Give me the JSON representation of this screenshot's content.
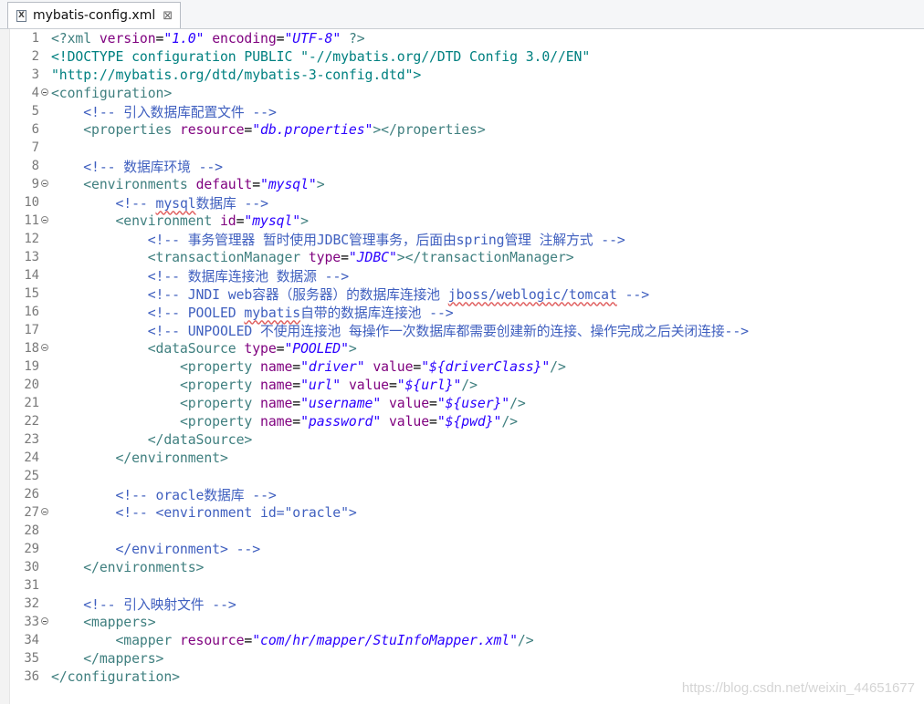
{
  "tab": {
    "title": "mybatis-config.xml",
    "icon": "xml-file-icon",
    "close_glyph": "⊠"
  },
  "watermark": "https://blog.csdn.net/weixin_44651677",
  "lines": [
    {
      "n": "1",
      "fold": false,
      "tokens": [
        [
          "pi",
          "<?xml "
        ],
        [
          "attr",
          "version"
        ],
        [
          "txt",
          "="
        ],
        [
          "val",
          "\"1.0\""
        ],
        [
          "txt",
          " "
        ],
        [
          "attr",
          "encoding"
        ],
        [
          "txt",
          "="
        ],
        [
          "val",
          "\"UTF-8\""
        ],
        [
          "txt",
          " "
        ],
        [
          "pi",
          "?>"
        ]
      ]
    },
    {
      "n": "2",
      "fold": false,
      "tokens": [
        [
          "doc",
          "<!DOCTYPE configuration PUBLIC \"-//mybatis.org//DTD Config 3.0//EN\""
        ]
      ]
    },
    {
      "n": "3",
      "fold": false,
      "tokens": [
        [
          "doc",
          "\"http://mybatis.org/dtd/mybatis-3-config.dtd\">"
        ]
      ]
    },
    {
      "n": "4",
      "fold": true,
      "tokens": [
        [
          "tag",
          "<configuration>"
        ]
      ]
    },
    {
      "n": "5",
      "fold": false,
      "tokens": [
        [
          "txt",
          "    "
        ],
        [
          "com",
          "<!-- 引入数据库配置文件 -->"
        ]
      ]
    },
    {
      "n": "6",
      "fold": false,
      "tokens": [
        [
          "txt",
          "    "
        ],
        [
          "tag",
          "<properties "
        ],
        [
          "attr",
          "resource"
        ],
        [
          "txt",
          "="
        ],
        [
          "val",
          "\"db.properties\""
        ],
        [
          "tag",
          "></properties>"
        ]
      ]
    },
    {
      "n": "7",
      "fold": false,
      "tokens": []
    },
    {
      "n": "8",
      "fold": false,
      "tokens": [
        [
          "txt",
          "    "
        ],
        [
          "com",
          "<!-- 数据库环境 -->"
        ]
      ]
    },
    {
      "n": "9",
      "fold": true,
      "tokens": [
        [
          "txt",
          "    "
        ],
        [
          "tag",
          "<environments "
        ],
        [
          "attr",
          "default"
        ],
        [
          "txt",
          "="
        ],
        [
          "val",
          "\"mysql\""
        ],
        [
          "tag",
          ">"
        ]
      ]
    },
    {
      "n": "10",
      "fold": false,
      "tokens": [
        [
          "txt",
          "        "
        ],
        [
          "com",
          "<!-- "
        ],
        [
          "comspell",
          "mysql"
        ],
        [
          "com",
          "数据库 -->"
        ]
      ]
    },
    {
      "n": "11",
      "fold": true,
      "tokens": [
        [
          "txt",
          "        "
        ],
        [
          "tag",
          "<environment "
        ],
        [
          "attr",
          "id"
        ],
        [
          "txt",
          "="
        ],
        [
          "val",
          "\"mysql\""
        ],
        [
          "tag",
          ">"
        ]
      ]
    },
    {
      "n": "12",
      "fold": false,
      "tokens": [
        [
          "txt",
          "            "
        ],
        [
          "com",
          "<!-- 事务管理器 暂时使用JDBC管理事务，后面由spring管理 注解方式 -->"
        ]
      ]
    },
    {
      "n": "13",
      "fold": false,
      "tokens": [
        [
          "txt",
          "            "
        ],
        [
          "tag",
          "<transactionManager "
        ],
        [
          "attr",
          "type"
        ],
        [
          "txt",
          "="
        ],
        [
          "val",
          "\"JDBC\""
        ],
        [
          "tag",
          "></transactionManager>"
        ]
      ]
    },
    {
      "n": "14",
      "fold": false,
      "tokens": [
        [
          "txt",
          "            "
        ],
        [
          "com",
          "<!-- 数据库连接池 数据源 -->"
        ]
      ]
    },
    {
      "n": "15",
      "fold": false,
      "tokens": [
        [
          "txt",
          "            "
        ],
        [
          "com",
          "<!-- JNDI web容器（服务器）的数据库连接池 "
        ],
        [
          "comspell",
          "jboss/weblogic/tomcat"
        ],
        [
          "com",
          " -->"
        ]
      ]
    },
    {
      "n": "16",
      "fold": false,
      "tokens": [
        [
          "txt",
          "            "
        ],
        [
          "com",
          "<!-- POOLED "
        ],
        [
          "comspell",
          "mybatis"
        ],
        [
          "com",
          "自带的数据库连接池 -->"
        ]
      ]
    },
    {
      "n": "17",
      "fold": false,
      "tokens": [
        [
          "txt",
          "            "
        ],
        [
          "com",
          "<!-- UNPOOLED 不使用连接池 每操作一次数据库都需要创建新的连接、操作完成之后关闭连接-->"
        ]
      ]
    },
    {
      "n": "18",
      "fold": true,
      "tokens": [
        [
          "txt",
          "            "
        ],
        [
          "tag",
          "<dataSource "
        ],
        [
          "attr",
          "type"
        ],
        [
          "txt",
          "="
        ],
        [
          "val",
          "\"POOLED\""
        ],
        [
          "tag",
          ">"
        ]
      ]
    },
    {
      "n": "19",
      "fold": false,
      "tokens": [
        [
          "txt",
          "                "
        ],
        [
          "tag",
          "<property "
        ],
        [
          "attr",
          "name"
        ],
        [
          "txt",
          "="
        ],
        [
          "val",
          "\"driver\""
        ],
        [
          "txt",
          " "
        ],
        [
          "attr",
          "value"
        ],
        [
          "txt",
          "="
        ],
        [
          "val",
          "\"${driverClass}\""
        ],
        [
          "tag",
          "/>"
        ]
      ]
    },
    {
      "n": "20",
      "fold": false,
      "tokens": [
        [
          "txt",
          "                "
        ],
        [
          "tag",
          "<property "
        ],
        [
          "attr",
          "name"
        ],
        [
          "txt",
          "="
        ],
        [
          "val",
          "\"url\""
        ],
        [
          "txt",
          " "
        ],
        [
          "attr",
          "value"
        ],
        [
          "txt",
          "="
        ],
        [
          "val",
          "\"${url}\""
        ],
        [
          "tag",
          "/>"
        ]
      ]
    },
    {
      "n": "21",
      "fold": false,
      "tokens": [
        [
          "txt",
          "                "
        ],
        [
          "tag",
          "<property "
        ],
        [
          "attr",
          "name"
        ],
        [
          "txt",
          "="
        ],
        [
          "val",
          "\"username\""
        ],
        [
          "txt",
          " "
        ],
        [
          "attr",
          "value"
        ],
        [
          "txt",
          "="
        ],
        [
          "val",
          "\"${user}\""
        ],
        [
          "tag",
          "/>"
        ]
      ]
    },
    {
      "n": "22",
      "fold": false,
      "tokens": [
        [
          "txt",
          "                "
        ],
        [
          "tag",
          "<property "
        ],
        [
          "attr",
          "name"
        ],
        [
          "txt",
          "="
        ],
        [
          "val",
          "\"password\""
        ],
        [
          "txt",
          " "
        ],
        [
          "attr",
          "value"
        ],
        [
          "txt",
          "="
        ],
        [
          "val",
          "\"${pwd}\""
        ],
        [
          "tag",
          "/>"
        ]
      ]
    },
    {
      "n": "23",
      "fold": false,
      "tokens": [
        [
          "txt",
          "            "
        ],
        [
          "tag",
          "</dataSource>"
        ]
      ]
    },
    {
      "n": "24",
      "fold": false,
      "tokens": [
        [
          "txt",
          "        "
        ],
        [
          "tag",
          "</environment>"
        ]
      ]
    },
    {
      "n": "25",
      "fold": false,
      "tokens": []
    },
    {
      "n": "26",
      "fold": false,
      "tokens": [
        [
          "txt",
          "        "
        ],
        [
          "com",
          "<!-- oracle数据库 -->"
        ]
      ]
    },
    {
      "n": "27",
      "fold": true,
      "tokens": [
        [
          "txt",
          "        "
        ],
        [
          "com",
          "<!-- <environment id=\"oracle\">"
        ]
      ]
    },
    {
      "n": "28",
      "fold": false,
      "tokens": []
    },
    {
      "n": "29",
      "fold": false,
      "tokens": [
        [
          "txt",
          "        "
        ],
        [
          "com",
          "</environment> -->"
        ]
      ]
    },
    {
      "n": "30",
      "fold": false,
      "tokens": [
        [
          "txt",
          "    "
        ],
        [
          "tag",
          "</environments>"
        ]
      ]
    },
    {
      "n": "31",
      "fold": false,
      "tokens": []
    },
    {
      "n": "32",
      "fold": false,
      "tokens": [
        [
          "txt",
          "    "
        ],
        [
          "com",
          "<!-- 引入映射文件 -->"
        ]
      ]
    },
    {
      "n": "33",
      "fold": true,
      "tokens": [
        [
          "txt",
          "    "
        ],
        [
          "tag",
          "<mappers>"
        ]
      ]
    },
    {
      "n": "34",
      "fold": false,
      "tokens": [
        [
          "txt",
          "        "
        ],
        [
          "tag",
          "<mapper "
        ],
        [
          "attr",
          "resource"
        ],
        [
          "txt",
          "="
        ],
        [
          "val",
          "\"com/hr/mapper/StuInfoMapper.xml\""
        ],
        [
          "tag",
          "/>"
        ]
      ]
    },
    {
      "n": "35",
      "fold": false,
      "tokens": [
        [
          "txt",
          "    "
        ],
        [
          "tag",
          "</mappers>"
        ]
      ]
    },
    {
      "n": "36",
      "fold": false,
      "tokens": [
        [
          "tag",
          "</configuration>"
        ]
      ]
    }
  ]
}
